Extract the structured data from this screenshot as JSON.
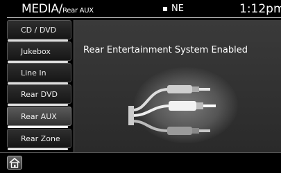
{
  "header": {
    "title_main": "MEDIA/",
    "title_sub": "Rear AUX",
    "status_text": "NE",
    "time": "1:12pm"
  },
  "sidebar": {
    "items": [
      {
        "label": "CD / DVD",
        "active": false
      },
      {
        "label": "Jukebox",
        "active": false
      },
      {
        "label": "Line In",
        "active": false
      },
      {
        "label": "Rear DVD",
        "active": false
      },
      {
        "label": "Rear AUX",
        "active": true
      },
      {
        "label": "Rear Zone",
        "active": false
      }
    ]
  },
  "main": {
    "headline": "Rear Entertainment System Enabled"
  },
  "icons": {
    "home": "home-icon",
    "av_cables": "rca-av-cables-icon"
  },
  "colors": {
    "background": "#000000",
    "panel": "#333333",
    "text": "#ffffff"
  }
}
